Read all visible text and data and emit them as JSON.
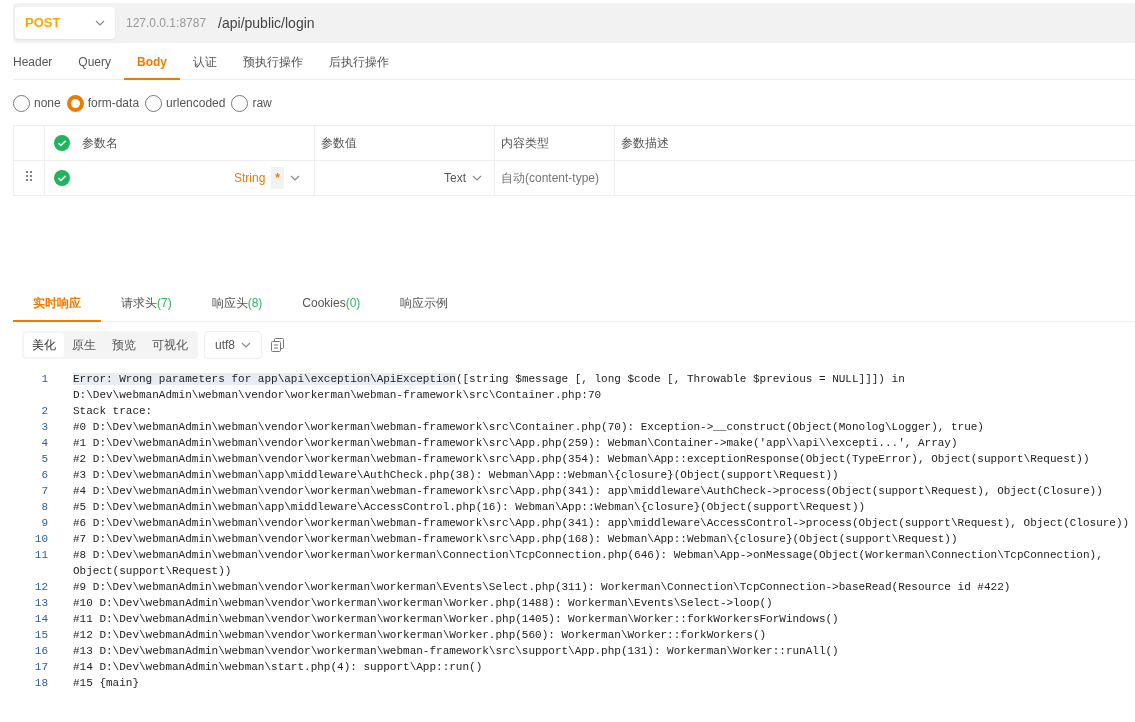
{
  "request": {
    "method": "POST",
    "base_url": "127.0.0.1:8787",
    "path": "/api/public/login"
  },
  "request_tabs": [
    {
      "label": "Header",
      "selected": false
    },
    {
      "label": "Query",
      "selected": false
    },
    {
      "label": "Body",
      "selected": true
    },
    {
      "label": "认证",
      "selected": false
    },
    {
      "label": "预执行操作",
      "selected": false
    },
    {
      "label": "后执行操作",
      "selected": false
    }
  ],
  "body_types": [
    {
      "label": "none",
      "selected": false
    },
    {
      "label": "form-data",
      "selected": true
    },
    {
      "label": "urlencoded",
      "selected": false
    },
    {
      "label": "raw",
      "selected": false
    }
  ],
  "params_table": {
    "all_enabled": true,
    "columns": [
      "参数名",
      "参数值",
      "内容类型",
      "参数描述"
    ],
    "rows": [
      {
        "enabled": true,
        "type": "String",
        "required_mark": "*",
        "value_type": "Text",
        "content_type_placeholder": "自动(content-type)"
      }
    ]
  },
  "response_tabs": [
    {
      "label": "实时响应",
      "selected": true
    },
    {
      "label": "请求头",
      "count": "(7)",
      "selected": false
    },
    {
      "label": "响应头",
      "count": "(8)",
      "selected": false
    },
    {
      "label": "Cookies",
      "count": "(0)",
      "selected": false
    },
    {
      "label": "响应示例",
      "selected": false
    }
  ],
  "view_modes": [
    {
      "label": "美化",
      "selected": true
    },
    {
      "label": "原生",
      "selected": false
    },
    {
      "label": "预览",
      "selected": false
    },
    {
      "label": "可视化",
      "selected": false
    }
  ],
  "encoding": "utf8",
  "code_lines": [
    {
      "number": "1",
      "highlight": "Error: Wrong parameters for app\\api\\exception\\ApiException",
      "text": "([string $message [, long $code [, Throwable $previous = NULL]]]) in D:\\Dev\\webmanAdmin\\webman\\vendor\\workerman\\webman-framework\\src\\Container.php:70"
    },
    {
      "number": "2",
      "text": "Stack trace:"
    },
    {
      "number": "3",
      "text": "#0 D:\\Dev\\webmanAdmin\\webman\\vendor\\workerman\\webman-framework\\src\\Container.php(70): Exception->__construct(Object(Monolog\\Logger), true)"
    },
    {
      "number": "4",
      "text": "#1 D:\\Dev\\webmanAdmin\\webman\\vendor\\workerman\\webman-framework\\src\\App.php(259): Webman\\Container->make('app\\\\api\\\\excepti...', Array)"
    },
    {
      "number": "5",
      "text": "#2 D:\\Dev\\webmanAdmin\\webman\\vendor\\workerman\\webman-framework\\src\\App.php(354): Webman\\App::exceptionResponse(Object(TypeError), Object(support\\Request))"
    },
    {
      "number": "6",
      "text": "#3 D:\\Dev\\webmanAdmin\\webman\\app\\middleware\\AuthCheck.php(38): Webman\\App::Webman\\{closure}(Object(support\\Request))"
    },
    {
      "number": "7",
      "text": "#4 D:\\Dev\\webmanAdmin\\webman\\vendor\\workerman\\webman-framework\\src\\App.php(341): app\\middleware\\AuthCheck->process(Object(support\\Request), Object(Closure))"
    },
    {
      "number": "8",
      "text": "#5 D:\\Dev\\webmanAdmin\\webman\\app\\middleware\\AccessControl.php(16): Webman\\App::Webman\\{closure}(Object(support\\Request))"
    },
    {
      "number": "9",
      "text": "#6 D:\\Dev\\webmanAdmin\\webman\\vendor\\workerman\\webman-framework\\src\\App.php(341): app\\middleware\\AccessControl->process(Object(support\\Request), Object(Closure))"
    },
    {
      "number": "10",
      "text": "#7 D:\\Dev\\webmanAdmin\\webman\\vendor\\workerman\\webman-framework\\src\\App.php(168): Webman\\App::Webman\\{closure}(Object(support\\Request))"
    },
    {
      "number": "11",
      "text": "#8 D:\\Dev\\webmanAdmin\\webman\\vendor\\workerman\\workerman\\Connection\\TcpConnection.php(646): Webman\\App->onMessage(Object(Workerman\\Connection\\TcpConnection), Object(support\\Request))"
    },
    {
      "number": "12",
      "text": "#9 D:\\Dev\\webmanAdmin\\webman\\vendor\\workerman\\workerman\\Events\\Select.php(311): Workerman\\Connection\\TcpConnection->baseRead(Resource id #422)"
    },
    {
      "number": "13",
      "text": "#10 D:\\Dev\\webmanAdmin\\webman\\vendor\\workerman\\workerman\\Worker.php(1488): Workerman\\Events\\Select->loop()"
    },
    {
      "number": "14",
      "text": "#11 D:\\Dev\\webmanAdmin\\webman\\vendor\\workerman\\workerman\\Worker.php(1405): Workerman\\Worker::forkWorkersForWindows()"
    },
    {
      "number": "15",
      "text": "#12 D:\\Dev\\webmanAdmin\\webman\\vendor\\workerman\\workerman\\Worker.php(560): Workerman\\Worker::forkWorkers()"
    },
    {
      "number": "16",
      "text": "#13 D:\\Dev\\webmanAdmin\\webman\\vendor\\workerman\\webman-framework\\src\\support\\App.php(131): Workerman\\Worker::runAll()"
    },
    {
      "number": "17",
      "text": "#14 D:\\Dev\\webmanAdmin\\webman\\start.php(4): support\\App::run()"
    },
    {
      "number": "18",
      "text": "#15 {main}"
    }
  ]
}
